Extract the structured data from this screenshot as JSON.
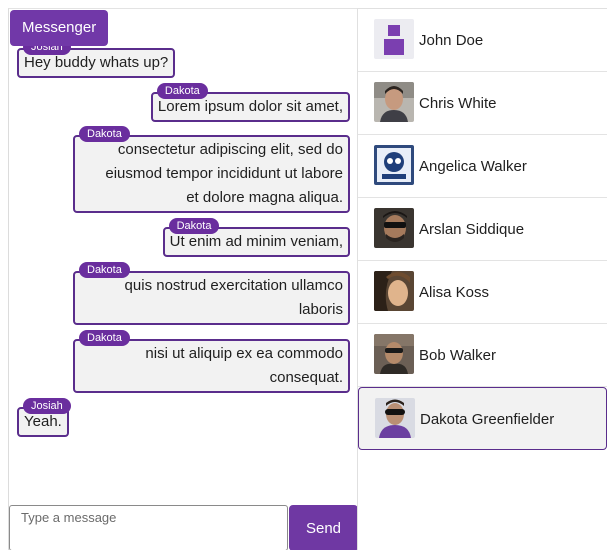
{
  "app": {
    "title": "Messenger"
  },
  "messages": [
    {
      "author": "Josiah",
      "lines": [
        "Hey buddy whats up?"
      ]
    },
    {
      "author": "Dakota",
      "lines": [
        "Lorem ipsum dolor sit amet,"
      ]
    },
    {
      "author": "Dakota",
      "lines": [
        "consectetur adipiscing elit, sed do",
        "eiusmod tempor incididunt ut labore",
        "et dolore magna aliqua."
      ]
    },
    {
      "author": "Dakota",
      "lines": [
        "Ut enim ad minim veniam,"
      ]
    },
    {
      "author": "Dakota",
      "lines": [
        "quis nostrud exercitation ullamco",
        "laboris"
      ]
    },
    {
      "author": "Dakota",
      "lines": [
        "nisi ut aliquip ex ea commodo",
        "consequat."
      ]
    },
    {
      "author": "Josiah",
      "lines": [
        "Yeah."
      ]
    }
  ],
  "composer": {
    "placeholder": "Type a message",
    "send_label": "Send"
  },
  "contacts": [
    {
      "name": "John Doe",
      "avatar": "default-person-icon",
      "selected": false
    },
    {
      "name": "Chris White",
      "avatar": "photo",
      "selected": false
    },
    {
      "name": "Angelica Walker",
      "avatar": "photo",
      "selected": false
    },
    {
      "name": "Arslan Siddique",
      "avatar": "photo",
      "selected": false
    },
    {
      "name": "Alisa Koss",
      "avatar": "photo",
      "selected": false
    },
    {
      "name": "Bob Walker",
      "avatar": "photo",
      "selected": false
    },
    {
      "name": "Dakota Greenfielder",
      "avatar": "photo",
      "selected": true
    }
  ],
  "colors": {
    "accent": "#6f38a3",
    "bubble_border": "#5a2d8c",
    "bubble_bg": "#f2f2f2"
  }
}
